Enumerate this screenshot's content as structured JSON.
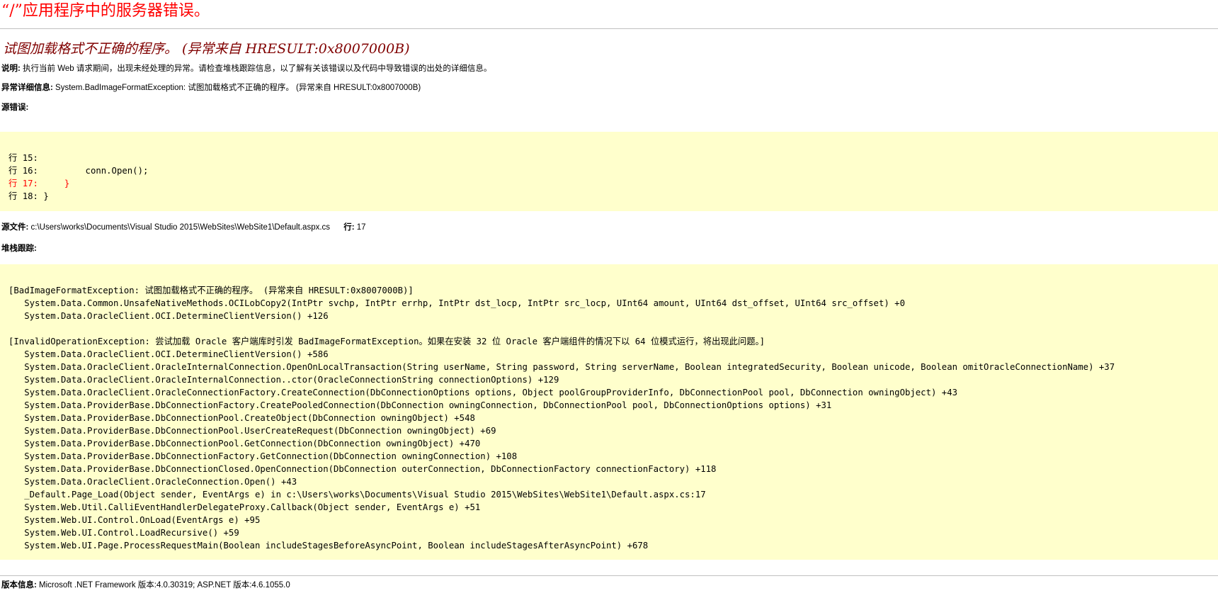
{
  "page": {
    "title": "“/”应用程序中的服务器错误。",
    "error_heading": "试图加载格式不正确的程序。 (异常来自 HRESULT:0x8007000B)"
  },
  "description": {
    "label": "说明:",
    "text": "执行当前 Web 请求期间，出现未经处理的异常。请检查堆栈跟踪信息，以了解有关该错误以及代码中导致错误的出处的详细信息。"
  },
  "exception_details": {
    "label": "异常详细信息:",
    "text": "System.BadImageFormatException: 试图加载格式不正确的程序。 (异常来自 HRESULT:0x8007000B)"
  },
  "source_error": {
    "label": "源错误:",
    "lines": [
      {
        "text": "行 15:",
        "highlight": false
      },
      {
        "text": "行 16:         conn.Open();",
        "highlight": false
      },
      {
        "text": "行 17:     }",
        "highlight": true
      },
      {
        "text": "行 18: }",
        "highlight": false
      }
    ]
  },
  "source_file": {
    "label": "源文件:",
    "path": "c:\\Users\\works\\Documents\\Visual Studio 2015\\WebSites\\WebSite1\\Default.aspx.cs",
    "line_label": "行:",
    "line_number": "17"
  },
  "stack_trace": {
    "label": "堆栈跟踪:",
    "groups": [
      {
        "exception": "[BadImageFormatException: 试图加载格式不正确的程序。 (异常来自 HRESULT:0x8007000B)]",
        "frames": [
          "System.Data.Common.UnsafeNativeMethods.OCILobCopy2(IntPtr svchp, IntPtr errhp, IntPtr dst_locp, IntPtr src_locp, UInt64 amount, UInt64 dst_offset, UInt64 src_offset) +0",
          "System.Data.OracleClient.OCI.DetermineClientVersion() +126"
        ]
      },
      {
        "exception": "[InvalidOperationException: 尝试加载 Oracle 客户端库时引发 BadImageFormatException。如果在安装 32 位 Oracle 客户端组件的情况下以 64 位模式运行，将出现此问题。]",
        "frames": [
          "System.Data.OracleClient.OCI.DetermineClientVersion() +586",
          "System.Data.OracleClient.OracleInternalConnection.OpenOnLocalTransaction(String userName, String password, String serverName, Boolean integratedSecurity, Boolean unicode, Boolean omitOracleConnectionName) +37",
          "System.Data.OracleClient.OracleInternalConnection..ctor(OracleConnectionString connectionOptions) +129",
          "System.Data.OracleClient.OracleConnectionFactory.CreateConnection(DbConnectionOptions options, Object poolGroupProviderInfo, DbConnectionPool pool, DbConnection owningObject) +43",
          "System.Data.ProviderBase.DbConnectionFactory.CreatePooledConnection(DbConnection owningConnection, DbConnectionPool pool, DbConnectionOptions options) +31",
          "System.Data.ProviderBase.DbConnectionPool.CreateObject(DbConnection owningObject) +548",
          "System.Data.ProviderBase.DbConnectionPool.UserCreateRequest(DbConnection owningObject) +69",
          "System.Data.ProviderBase.DbConnectionPool.GetConnection(DbConnection owningObject) +470",
          "System.Data.ProviderBase.DbConnectionFactory.GetConnection(DbConnection owningConnection) +108",
          "System.Data.ProviderBase.DbConnectionClosed.OpenConnection(DbConnection outerConnection, DbConnectionFactory connectionFactory) +118",
          "System.Data.OracleClient.OracleConnection.Open() +43",
          "_Default.Page_Load(Object sender, EventArgs e) in c:\\Users\\works\\Documents\\Visual Studio 2015\\WebSites\\WebSite1\\Default.aspx.cs:17",
          "System.Web.Util.CalliEventHandlerDelegateProxy.Callback(Object sender, EventArgs e) +51",
          "System.Web.UI.Control.OnLoad(EventArgs e) +95",
          "System.Web.UI.Control.LoadRecursive() +59",
          "System.Web.UI.Page.ProcessRequestMain(Boolean includeStagesBeforeAsyncPoint, Boolean includeStagesAfterAsyncPoint) +678"
        ]
      }
    ]
  },
  "version_info": {
    "label": "版本信息:",
    "text": "Microsoft .NET Framework 版本:4.0.30319; ASP.NET 版本:4.6.1055.0"
  },
  "colors": {
    "title": "#ff0000",
    "error_heading": "#800000",
    "code_background": "#ffffcc",
    "highlight_line": "#ff0000",
    "rule": "#c0c0c0"
  }
}
